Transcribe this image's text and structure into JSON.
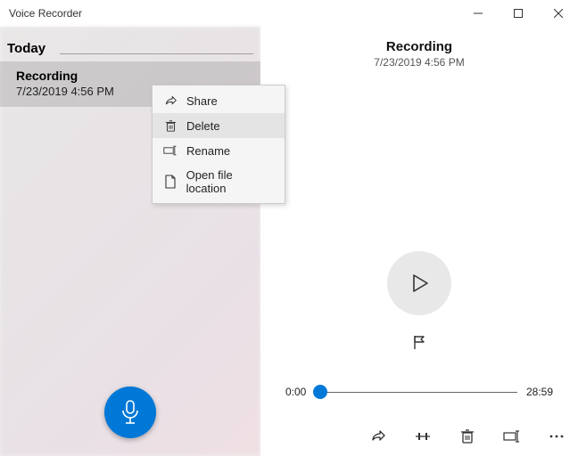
{
  "window": {
    "title": "Voice Recorder"
  },
  "sidebar": {
    "section": "Today",
    "item": {
      "title": "Recording",
      "date": "7/23/2019 4:56 PM"
    }
  },
  "context_menu": {
    "items": [
      {
        "icon": "share-icon",
        "label": "Share"
      },
      {
        "icon": "trash-icon",
        "label": "Delete"
      },
      {
        "icon": "rename-icon",
        "label": "Rename"
      },
      {
        "icon": "folder-icon",
        "label": "Open file location"
      }
    ],
    "hovered_index": 1
  },
  "detail": {
    "title": "Recording",
    "date": "7/23/2019 4:56 PM",
    "time_start": "0:00",
    "time_end": "28:59"
  },
  "colors": {
    "accent": "#0078d7"
  }
}
